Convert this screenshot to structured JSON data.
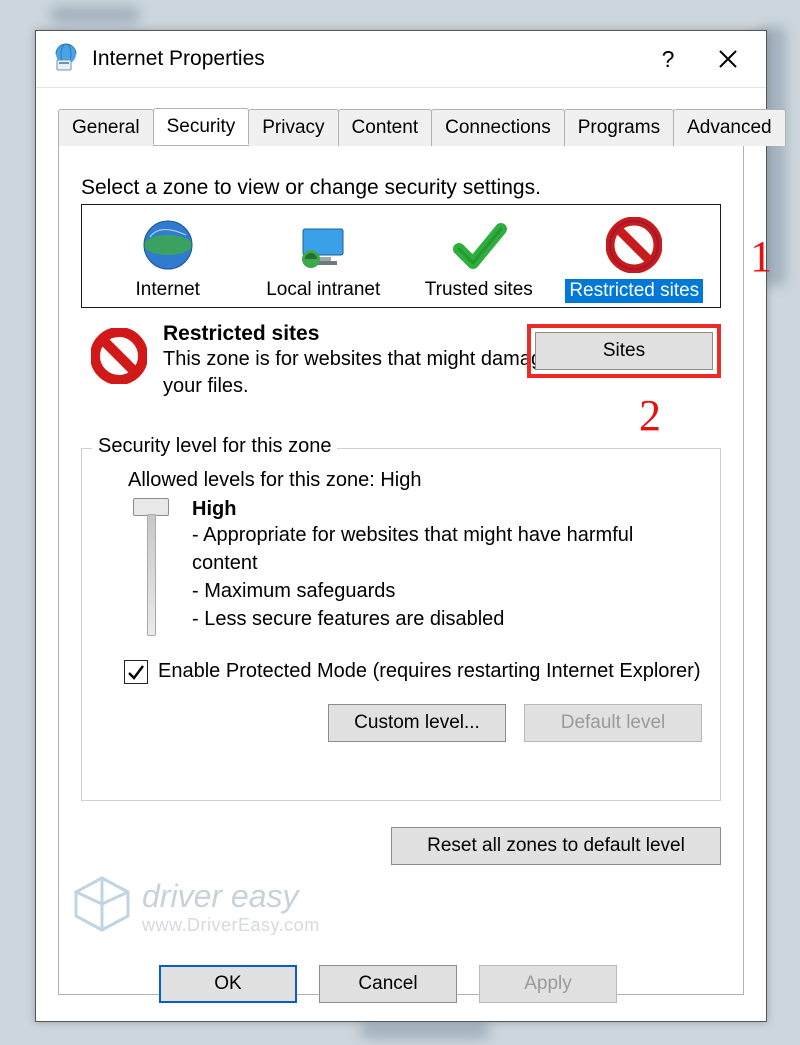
{
  "title": "Internet Properties",
  "tabs": [
    "General",
    "Security",
    "Privacy",
    "Content",
    "Connections",
    "Programs",
    "Advanced"
  ],
  "active_tab": 1,
  "zone_prompt": "Select a zone to view or change security settings.",
  "zones": [
    {
      "label": "Internet"
    },
    {
      "label": "Local intranet"
    },
    {
      "label": "Trusted sites"
    },
    {
      "label": "Restricted sites"
    }
  ],
  "selected_zone": 3,
  "annotation_1": "1",
  "annotation_2": "2",
  "zone_detail": {
    "title": "Restricted sites",
    "body": "This zone is for websites that might damage your computer or your files.",
    "sites_button": "Sites"
  },
  "level": {
    "legend": "Security level for this zone",
    "allowed": "Allowed levels for this zone: High",
    "name": "High",
    "bullets": [
      "- Appropriate for websites that might have harmful content",
      "- Maximum safeguards",
      "- Less secure features are disabled"
    ],
    "protected_label": "Enable Protected Mode (requires restarting Internet Explorer)",
    "protected_checked": true,
    "custom_button": "Custom level...",
    "default_button": "Default level",
    "reset_button": "Reset all zones to default level"
  },
  "buttons": {
    "ok": "OK",
    "cancel": "Cancel",
    "apply": "Apply"
  },
  "watermark": {
    "line1": "driver easy",
    "line2": "www.DriverEasy.com"
  }
}
